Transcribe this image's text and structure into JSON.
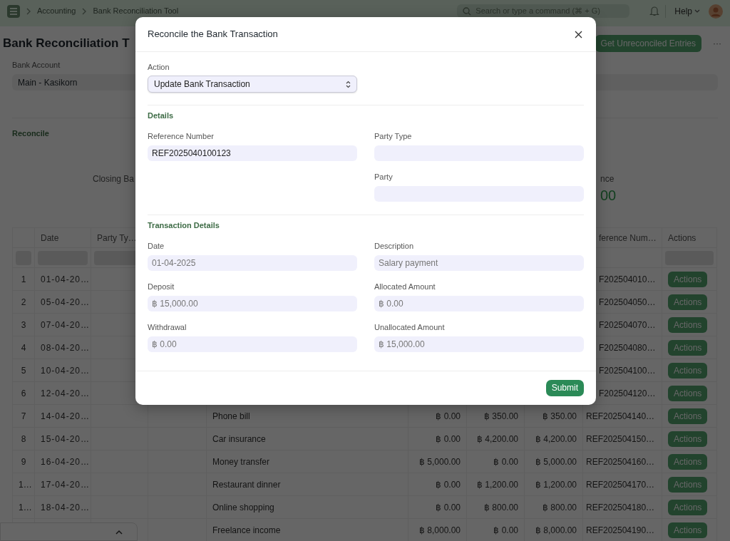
{
  "navbar": {
    "breadcrumbs": [
      {
        "label": "Accounting"
      },
      {
        "label": "Bank Reconciliation Tool"
      }
    ],
    "search": {
      "placeholder": "Search or type a command (⌘ + G)"
    },
    "help": "Help"
  },
  "page": {
    "title": "Bank Reconciliation T",
    "primary_button": "Get Unreconciled Entries",
    "more_button": "···"
  },
  "bank_account": {
    "label": "Bank Account",
    "value": "Main - Kasikorn"
  },
  "reconcile": {
    "heading": "Reconcile",
    "balances": [
      {
        "label": "Closing Ba"
      },
      {
        "label": "nce",
        "value": "00"
      }
    ]
  },
  "table": {
    "columns": [
      {
        "label": "Date"
      },
      {
        "label": "Party Ty…"
      },
      {
        "label": "ference Num…"
      },
      {
        "label": "Actions"
      }
    ],
    "rows": [
      {
        "number": "1",
        "date": "01-04-20…",
        "reference": "F202504010…",
        "action": "Actions"
      },
      {
        "number": "2",
        "date": "05-04-20…",
        "reference": "F202504050…",
        "action": "Actions"
      },
      {
        "number": "3",
        "date": "07-04-20…",
        "reference": "F202504070…",
        "action": "Actions"
      },
      {
        "number": "4",
        "date": "08-04-20…",
        "reference": "F202504080…",
        "action": "Actions"
      },
      {
        "number": "5",
        "date": "10-04-20…",
        "reference": "F202504100…",
        "action": "Actions"
      },
      {
        "number": "6",
        "date": "12-04-20…",
        "reference": "F202504120…",
        "action": "Actions"
      },
      {
        "number": "7",
        "date": "14-04-20…",
        "description": "Phone bill",
        "deposit": "฿ 0.00",
        "withdrawal": "฿ 350.00",
        "unallocated": "฿ 350.00",
        "reference": "REF202504140…",
        "action": "Actions"
      },
      {
        "number": "8",
        "date": "15-04-20…",
        "description": "Car insurance",
        "deposit": "฿ 0.00",
        "withdrawal": "฿ 4,200.00",
        "unallocated": "฿ 4,200.00",
        "reference": "REF202504150…",
        "action": "Actions"
      },
      {
        "number": "9",
        "date": "16-04-20…",
        "description": "Money transfer",
        "deposit": "฿ 5,000.00",
        "withdrawal": "฿ 0.00",
        "unallocated": "฿ 5,000.00",
        "reference": "REF202504160…",
        "action": "Actions"
      },
      {
        "number": "1…",
        "date": "17-04-20…",
        "description": "Restaurant dinner",
        "deposit": "฿ 0.00",
        "withdrawal": "฿ 1,200.00",
        "unallocated": "฿ 1,200.00",
        "reference": "REF202504170…",
        "action": "Actions"
      },
      {
        "number": "1…",
        "date": "18-04-20…",
        "description": "Online shopping",
        "deposit": "฿ 0.00",
        "withdrawal": "฿ 800.00",
        "unallocated": "฿ 800.00",
        "reference": "REF202504180…",
        "action": "Actions"
      },
      {
        "description": "Freelance income",
        "deposit": "฿ 8,000.00",
        "withdrawal": "฿ 0.00",
        "unallocated": "฿ 8,000.00",
        "reference": "REF202504190…",
        "action": "Actions"
      }
    ]
  },
  "dialog": {
    "title": "Reconcile the Bank Transaction",
    "action": {
      "label": "Action",
      "value": "Update Bank Transaction"
    },
    "sections": [
      {
        "heading": "Details",
        "columns": [
          [
            {
              "label": "Reference Number",
              "value": "REF2025040100123",
              "read_only": false
            }
          ],
          [
            {
              "label": "Party Type"
            },
            {
              "label": "Party"
            }
          ]
        ]
      },
      {
        "heading": "Transaction Details",
        "columns": [
          [
            {
              "label": "Date",
              "value": "01-04-2025",
              "read_only": true
            },
            {
              "label": "Deposit",
              "value": "฿ 15,000.00",
              "read_only": true
            },
            {
              "label": "Withdrawal",
              "value": "฿ 0.00",
              "read_only": true
            }
          ],
          [
            {
              "label": "Description",
              "value": "Salary payment",
              "read_only": true
            },
            {
              "label": "Allocated Amount",
              "value": "฿ 0.00",
              "read_only": true
            },
            {
              "label": "Unallocated Amount",
              "value": "฿ 15,000.00",
              "read_only": true
            }
          ]
        ]
      }
    ],
    "submit": "Submit"
  }
}
